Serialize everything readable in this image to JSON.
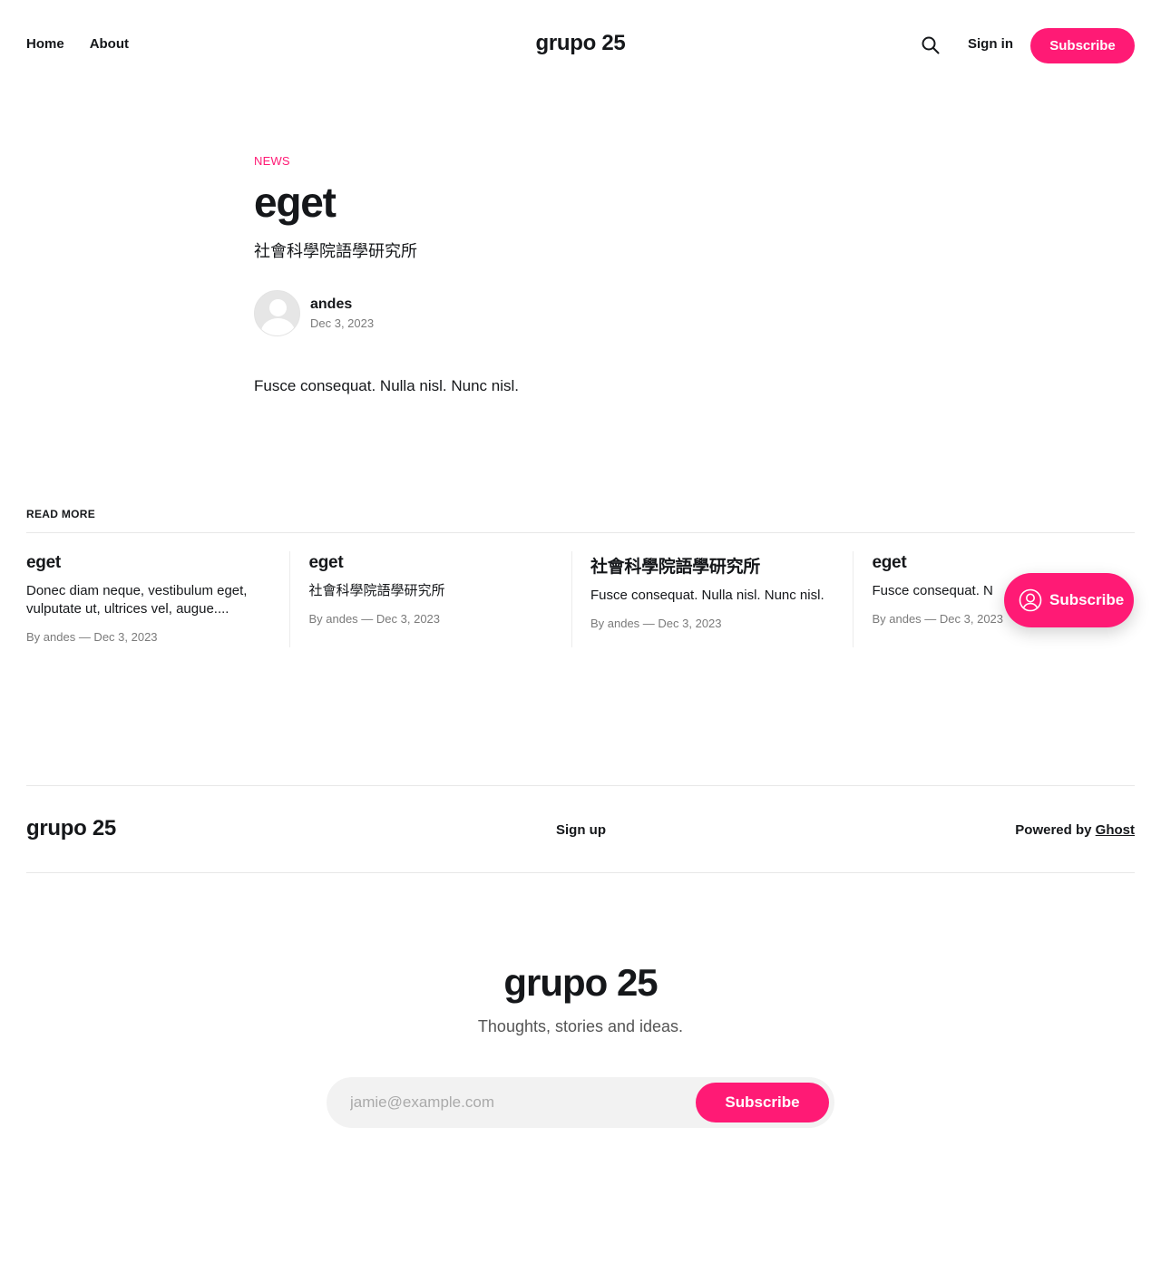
{
  "header": {
    "nav": [
      "Home",
      "About"
    ],
    "logo": "grupo 25",
    "search_icon": "search-icon",
    "signin_label": "Sign in",
    "subscribe_label": "Subscribe"
  },
  "colors": {
    "accent": "#ff1a75",
    "text": "#15171a",
    "muted": "#7a7a7a"
  },
  "article": {
    "tag": "NEWS",
    "title": "eget",
    "excerpt": "社會科學院語學研究所",
    "author": "andes",
    "date": "Dec 3, 2023",
    "content": "Fusce consequat. Nulla nisl. Nunc nisl."
  },
  "readmore": {
    "title": "READ MORE",
    "cards": [
      {
        "title": "eget",
        "excerpt": "Donec diam neque, vestibulum eget, vulputate ut, ultrices vel, augue....",
        "meta": "By andes — Dec 3, 2023"
      },
      {
        "title": "eget",
        "excerpt": "社會科學院語學研究所",
        "meta": "By andes — Dec 3, 2023"
      },
      {
        "title": "社會科學院語學研究所",
        "excerpt": "Fusce consequat. Nulla nisl. Nunc nisl.",
        "meta": "By andes — Dec 3, 2023"
      },
      {
        "title": "eget",
        "excerpt": "Fusce consequat. N",
        "meta": "By andes — Dec 3, 2023"
      }
    ]
  },
  "floating_subscribe": {
    "label": "Subscribe",
    "icon": "member-icon"
  },
  "footer": {
    "logo": "grupo 25",
    "signup": "Sign up",
    "powered_prefix": "Powered by ",
    "powered_link": "Ghost"
  },
  "cta": {
    "title": "grupo 25",
    "subtitle": "Thoughts, stories and ideas.",
    "placeholder": "jamie@example.com",
    "button": "Subscribe"
  }
}
